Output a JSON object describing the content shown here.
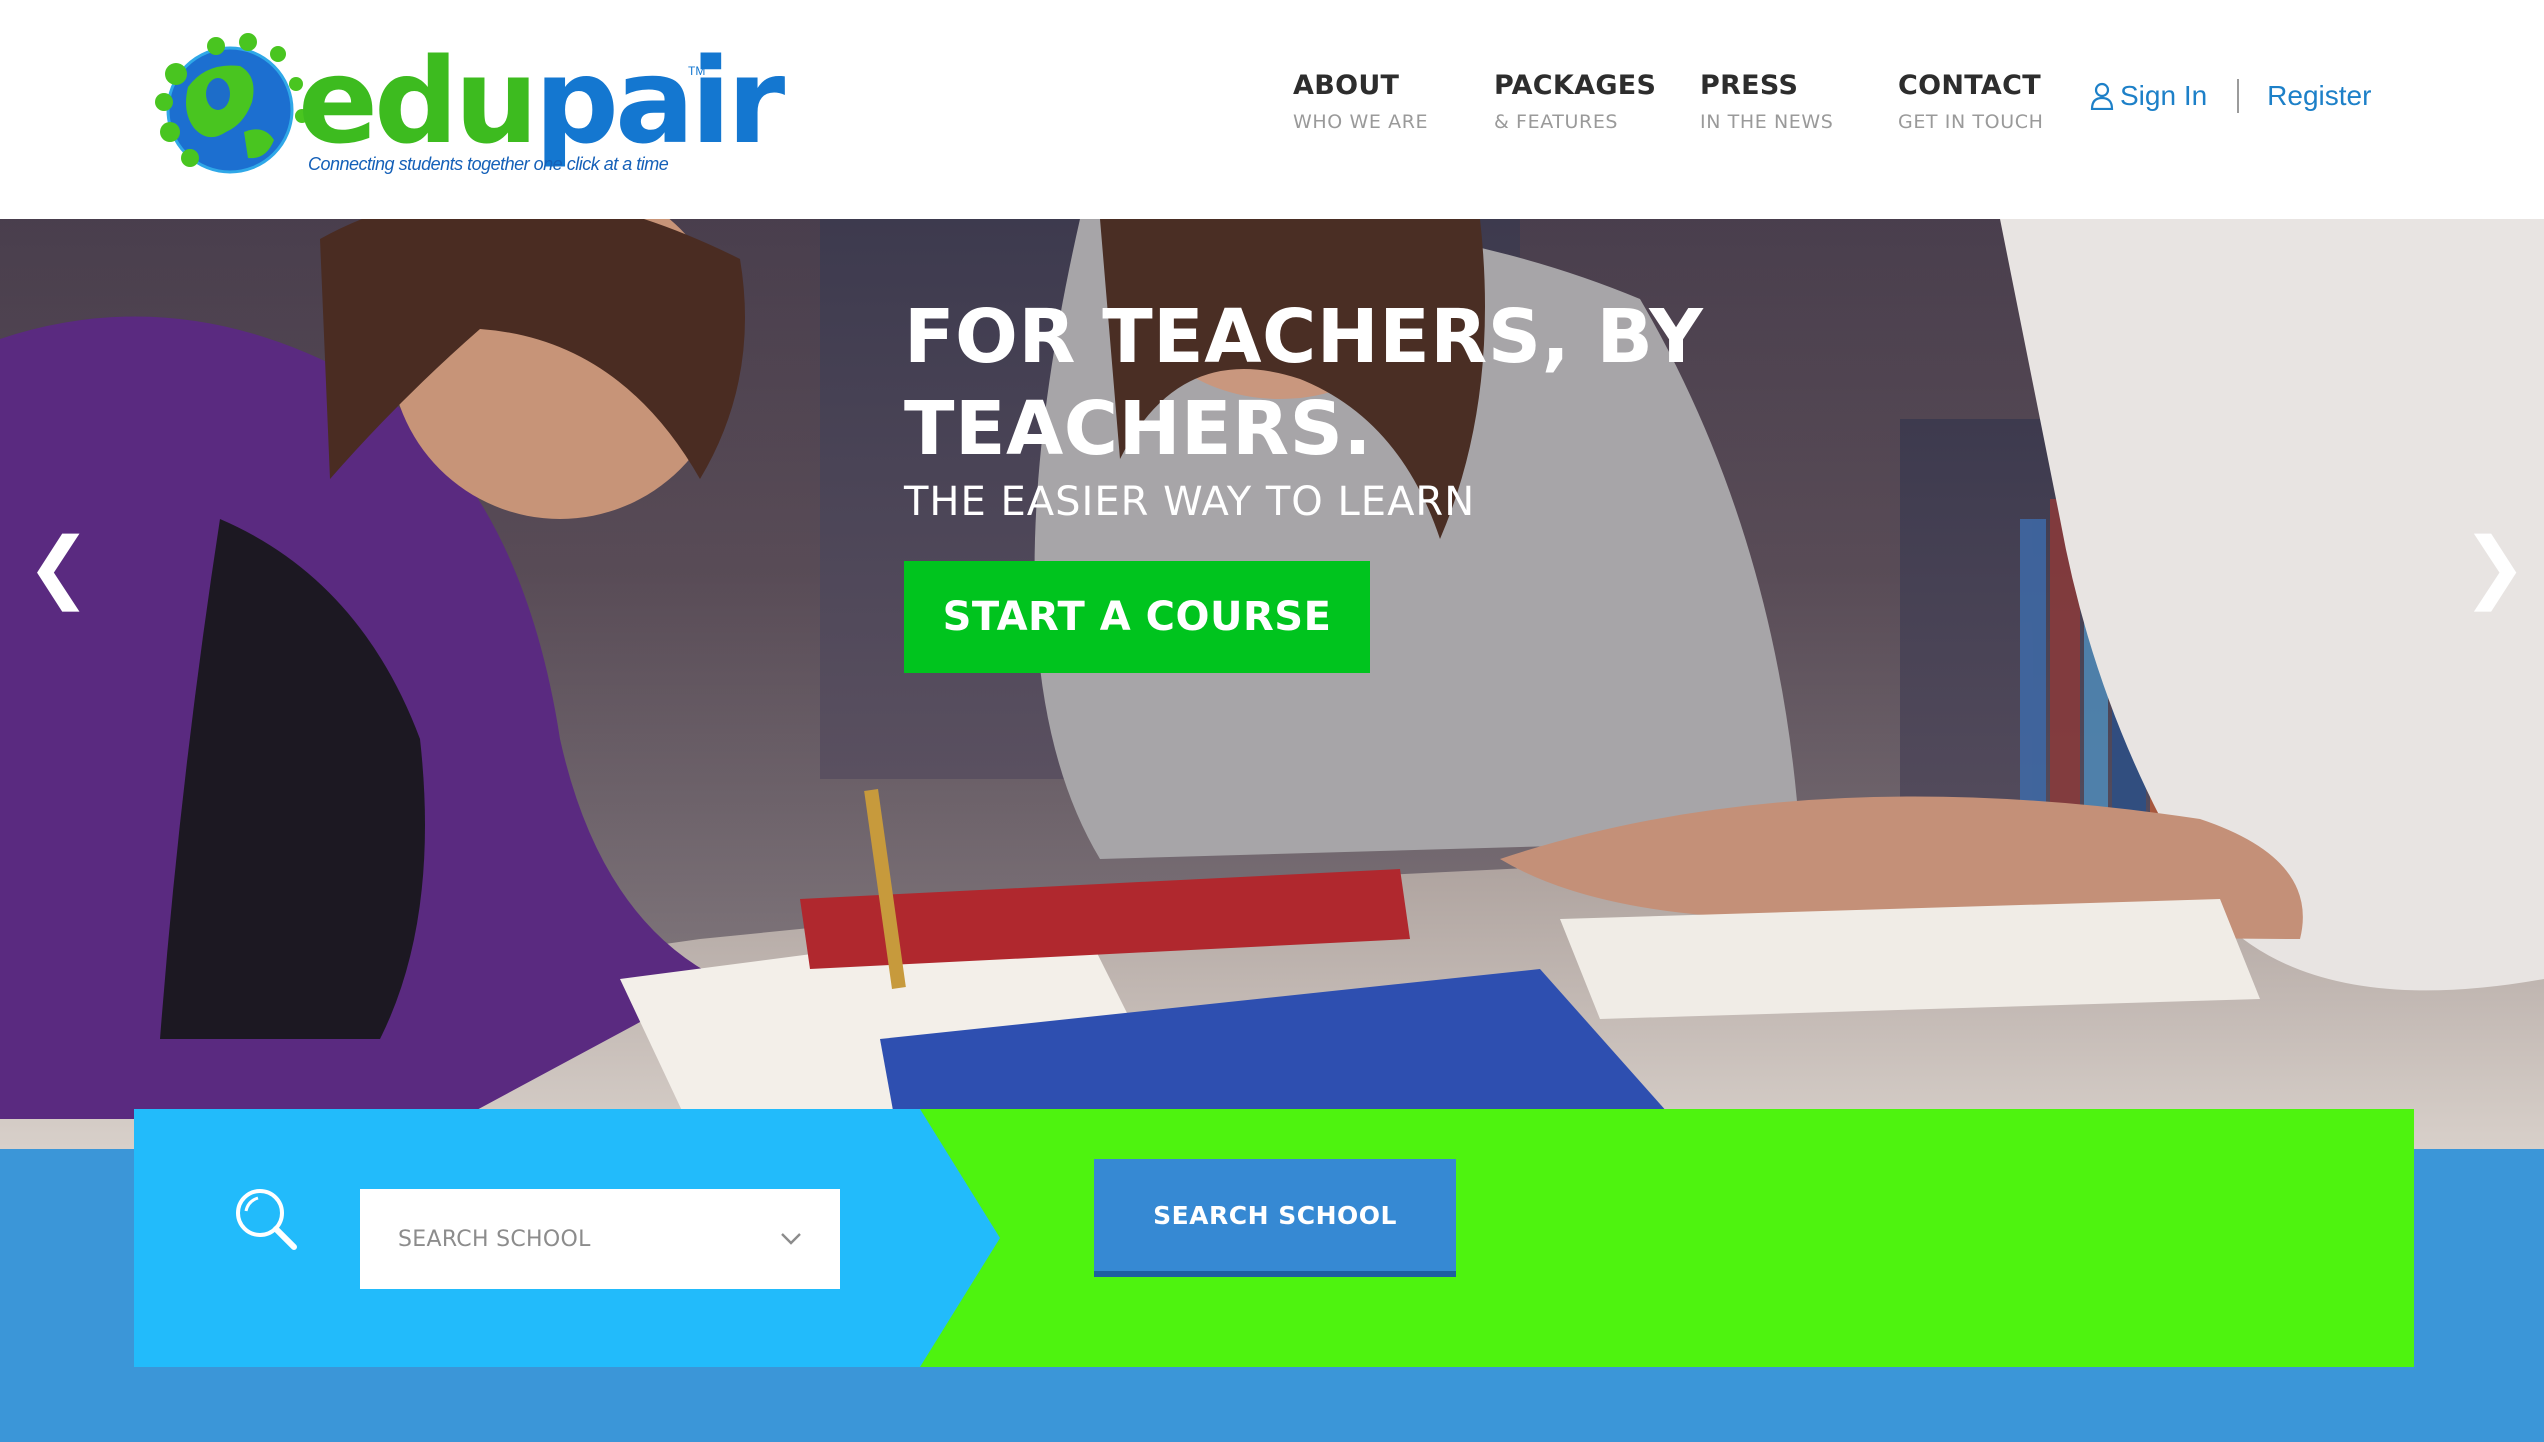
{
  "logo": {
    "word_edu": "edu",
    "word_pair": "pair",
    "trademark": "TM",
    "tagline": "Connecting students together one click at a time"
  },
  "nav": {
    "items": [
      {
        "title": "ABOUT",
        "sub": "WHO WE ARE"
      },
      {
        "title": "PACKAGES",
        "sub": "& FEATURES"
      },
      {
        "title": "PRESS",
        "sub": "IN THE NEWS"
      },
      {
        "title": "CONTACT",
        "sub": "GET IN TOUCH"
      }
    ],
    "sign_in": "Sign In",
    "register": "Register"
  },
  "hero": {
    "title": "FOR TEACHERS, BY TEACHERS.",
    "subtitle": "THE EASIER WAY TO LEARN",
    "cta": "START A COURSE",
    "prev_arrow": "❮",
    "next_arrow": "❯"
  },
  "search": {
    "select_placeholder": "SEARCH SCHOOL",
    "button_label": "SEARCH SCHOOL"
  },
  "colors": {
    "brand_green": "#3dbb1f",
    "brand_blue": "#1477d0",
    "cta_green": "#00c41e",
    "band_blue": "#22bbfb",
    "band_green": "#4ef30f",
    "button_blue": "#3689d3",
    "footer_blue": "#3b96d8"
  },
  "icons": [
    "globe-logo-icon",
    "user-icon",
    "chevron-left-icon",
    "chevron-right-icon",
    "search-icon",
    "chevron-down-icon"
  ]
}
